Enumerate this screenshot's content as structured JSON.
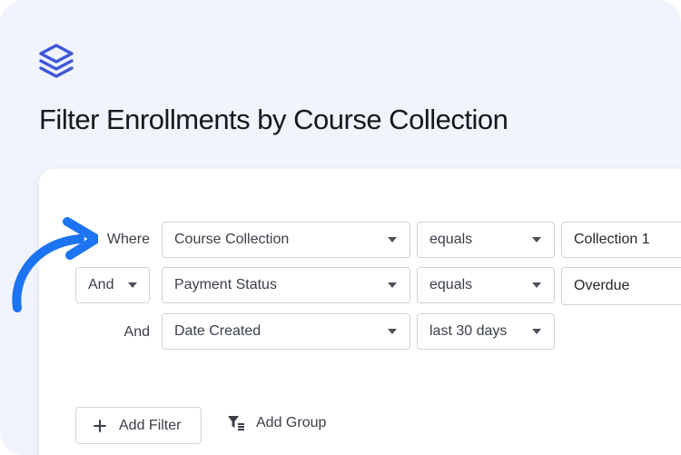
{
  "title": "Filter Enrollments by Course Collection",
  "filters": [
    {
      "connector": "Where",
      "field": "Course Collection",
      "operator": "equals",
      "value": "Collection 1"
    },
    {
      "connector": "And",
      "field": "Payment Status",
      "operator": "equals",
      "value": "Overdue"
    },
    {
      "connector": "And",
      "field": "Date Created",
      "operator": "last 30 days",
      "value": ""
    }
  ],
  "actions": {
    "add_filter": "Add Filter",
    "add_group": "Add Group"
  },
  "colors": {
    "accent": "#1c74f2",
    "logo": "#3f57d9",
    "background": "#f1f4fd"
  },
  "icons": [
    "stack-layers-icon",
    "curved-arrow-icon",
    "chevron-down-icon",
    "plus-icon",
    "filter-lines-icon"
  ]
}
